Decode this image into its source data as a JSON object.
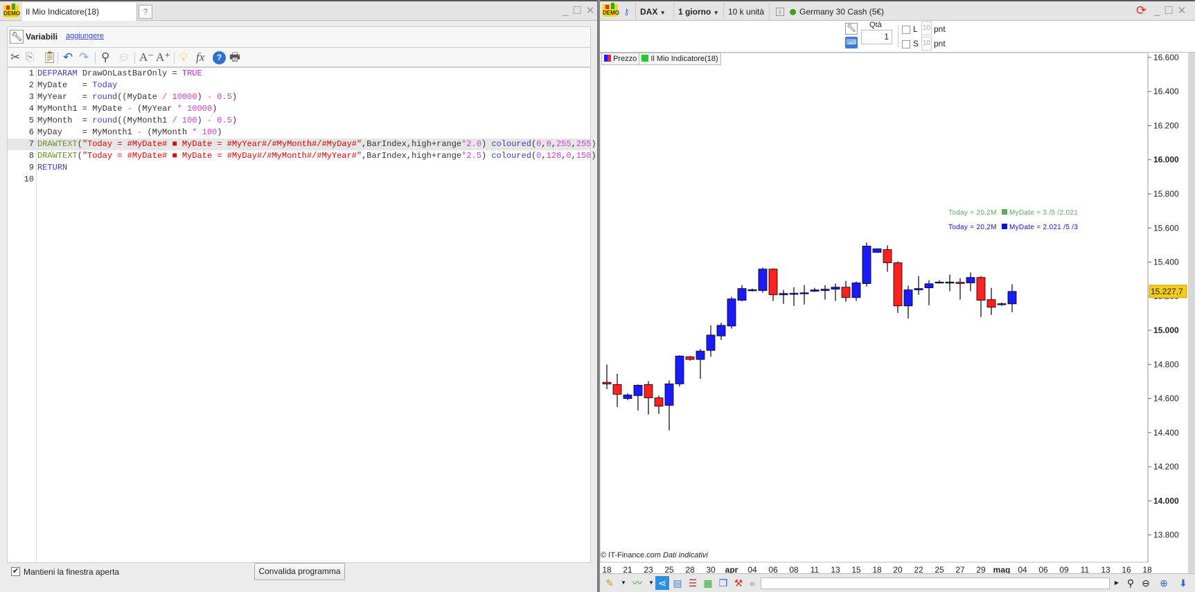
{
  "editor": {
    "tab_title": "Il Mio Indicatore(18)",
    "demo_badge": "DEMO",
    "variables_label": "Variabili",
    "add_link": "aggiungere",
    "keep_open_label": "Mantieni la finestra aperta",
    "keep_open_checked": true,
    "validate_button": "Convalida programma",
    "highlighted_line": 7,
    "code_lines": [
      [
        [
          "kw",
          "DEFPARAM "
        ],
        [
          "id",
          "DrawOnLastBarOnly = "
        ],
        [
          "lit",
          "TRUE"
        ]
      ],
      [
        [
          "id",
          "MyDate   = "
        ],
        [
          "fn",
          "Today"
        ]
      ],
      [
        [
          "id",
          "MyYear   = "
        ],
        [
          "fn",
          "round"
        ],
        [
          "id",
          "((MyDate "
        ],
        [
          "op",
          "/ "
        ],
        [
          "num",
          "10000"
        ],
        [
          "id",
          ") "
        ],
        [
          "op",
          "- "
        ],
        [
          "num",
          "0.5"
        ],
        [
          "id",
          ")"
        ]
      ],
      [
        [
          "id",
          "MyMonth1 = MyDate "
        ],
        [
          "op",
          "- "
        ],
        [
          "id",
          "(MyYear "
        ],
        [
          "op",
          "* "
        ],
        [
          "num",
          "10000"
        ],
        [
          "id",
          ")"
        ]
      ],
      [
        [
          "id",
          "MyMonth  = "
        ],
        [
          "fn",
          "round"
        ],
        [
          "id",
          "((MyMonth1 "
        ],
        [
          "op",
          "/ "
        ],
        [
          "num",
          "100"
        ],
        [
          "id",
          ") "
        ],
        [
          "op",
          "- "
        ],
        [
          "num",
          "0.5"
        ],
        [
          "id",
          ")"
        ]
      ],
      [
        [
          "id",
          "MyDay    = MyMonth1 "
        ],
        [
          "op",
          "- "
        ],
        [
          "id",
          "(MyMonth "
        ],
        [
          "op",
          "* "
        ],
        [
          "num",
          "100"
        ],
        [
          "id",
          ")"
        ]
      ],
      [
        [
          "dt",
          "DRAWTEXT"
        ],
        [
          "id",
          "("
        ],
        [
          "str",
          "\"Today = #MyDate# "
        ],
        [
          "sq",
          "■"
        ],
        [
          "str",
          " MyDate = #MyYear#/#MyMonth#/#MyDay#\""
        ],
        [
          "id",
          ",BarIndex,high+range"
        ],
        [
          "op",
          "*"
        ],
        [
          "num",
          "2.0"
        ],
        [
          "id",
          ") "
        ],
        [
          "fn",
          "coloured"
        ],
        [
          "id",
          "("
        ],
        [
          "num",
          "0"
        ],
        [
          "id",
          ","
        ],
        [
          "num",
          "0"
        ],
        [
          "id",
          ","
        ],
        [
          "num",
          "255"
        ],
        [
          "id",
          ","
        ],
        [
          "num",
          "255"
        ],
        [
          "id",
          ")"
        ]
      ],
      [
        [
          "dt",
          "DRAWTEXT"
        ],
        [
          "id",
          "("
        ],
        [
          "str",
          "\"Today = #MyDate# "
        ],
        [
          "sq",
          "■"
        ],
        [
          "str",
          " MyDate = #MyDay#/#MyMonth#/#MyYear#\""
        ],
        [
          "id",
          ",BarIndex,high+range"
        ],
        [
          "op",
          "*"
        ],
        [
          "num",
          "2.5"
        ],
        [
          "id",
          ") "
        ],
        [
          "fn",
          "coloured"
        ],
        [
          "id",
          "("
        ],
        [
          "num",
          "0"
        ],
        [
          "id",
          ","
        ],
        [
          "num",
          "128"
        ],
        [
          "id",
          ","
        ],
        [
          "num",
          "0"
        ],
        [
          "id",
          ","
        ],
        [
          "num",
          "150"
        ],
        [
          "id",
          ")"
        ]
      ],
      [
        [
          "kw",
          "RETURN"
        ]
      ],
      []
    ]
  },
  "chart_window": {
    "instrument": "DAX",
    "timeframe": "1 giorno",
    "units": "10 k unità",
    "market_name": "Germany 30 Cash (5€)",
    "qty_label": "Qtà",
    "qty_value": "1",
    "long_label": "L",
    "short_label": "S",
    "long_pts": "10",
    "short_pts": "10",
    "pts_unit": "pnt",
    "legend": [
      {
        "label": "Prezzo"
      },
      {
        "label": "Il Mio Indicatore(18)"
      }
    ],
    "copyright": "© IT-Finance.com",
    "disclaimer": "Dati indicativi",
    "annotation_green": {
      "today": "Today = 20,2M",
      "mydate": "MyDate = 3 /5 /2.021",
      "color": "#5fa85f"
    },
    "annotation_blue": {
      "today": "Today = 20,2M",
      "mydate": "MyDate = 2.021 /5 /3",
      "color": "#1010d0"
    },
    "last_price": "15.227,7"
  },
  "chart_data": {
    "type": "candlestick",
    "ylim": [
      13640,
      16612
    ],
    "y_ticks": [
      "13.800",
      "14.000",
      "14.200",
      "14.400",
      "14.600",
      "14.800",
      "15.000",
      "15.200",
      "15.400",
      "15.600",
      "15.800",
      "16.000",
      "16.200",
      "16.400",
      "16.600"
    ],
    "y_tick_values": [
      13800,
      14000,
      14200,
      14400,
      14600,
      14800,
      15000,
      15200,
      15400,
      15600,
      15800,
      16000,
      16200,
      16400,
      16600
    ],
    "x_labels": [
      "18",
      "21",
      "23",
      "25",
      "28",
      "30",
      "apr",
      "04",
      "06",
      "08",
      "11",
      "13",
      "15",
      "18",
      "20",
      "22",
      "25",
      "27",
      "29",
      "mag",
      "04",
      "06",
      "09",
      "11",
      "13",
      "16",
      "18"
    ],
    "up_color": "#1a1aff",
    "down_color": "#ff2020",
    "ohlc": [
      [
        14695,
        14800,
        14655,
        14685
      ],
      [
        14682,
        14745,
        14550,
        14625
      ],
      [
        14600,
        14630,
        14590,
        14621
      ],
      [
        14617,
        14682,
        14530,
        14678
      ],
      [
        14682,
        14702,
        14506,
        14604
      ],
      [
        14604,
        14617,
        14510,
        14555
      ],
      [
        14560,
        14706,
        14413,
        14686
      ],
      [
        14686,
        14853,
        14670,
        14849
      ],
      [
        14845,
        14849,
        14822,
        14829
      ],
      [
        14829,
        14890,
        14715,
        14878
      ],
      [
        14882,
        15029,
        14845,
        14972
      ],
      [
        14967,
        15045,
        14943,
        15029
      ],
      [
        15025,
        15196,
        15010,
        15184
      ],
      [
        15176,
        15265,
        15170,
        15245
      ],
      [
        15233,
        15245,
        15228,
        15238
      ],
      [
        15233,
        15367,
        15221,
        15359
      ],
      [
        15359,
        15363,
        15172,
        15208
      ],
      [
        15208,
        15237,
        15155,
        15216
      ],
      [
        15216,
        15253,
        15143,
        15217
      ],
      [
        15216,
        15265,
        15151,
        15220
      ],
      [
        15229,
        15249,
        15225,
        15237
      ],
      [
        15233,
        15265,
        15180,
        15241
      ],
      [
        15241,
        15274,
        15172,
        15253
      ],
      [
        15253,
        15290,
        15168,
        15192
      ],
      [
        15192,
        15286,
        15172,
        15278
      ],
      [
        15274,
        15515,
        15257,
        15494
      ],
      [
        15457,
        15480,
        15455,
        15478
      ],
      [
        15473,
        15498,
        15343,
        15396
      ],
      [
        15396,
        15404,
        15102,
        15143
      ],
      [
        15143,
        15262,
        15069,
        15237
      ],
      [
        15237,
        15318,
        15208,
        15245
      ],
      [
        15249,
        15294,
        15147,
        15273
      ],
      [
        15281,
        15294,
        15274,
        15283
      ],
      [
        15281,
        15327,
        15229,
        15283
      ],
      [
        15282,
        15306,
        15180,
        15274
      ],
      [
        15278,
        15339,
        15229,
        15310
      ],
      [
        15310,
        15318,
        15078,
        15176
      ],
      [
        15180,
        15249,
        15090,
        15135
      ],
      [
        15154,
        15163,
        15143,
        15156
      ],
      [
        15155,
        15270,
        15106,
        15228
      ]
    ]
  }
}
